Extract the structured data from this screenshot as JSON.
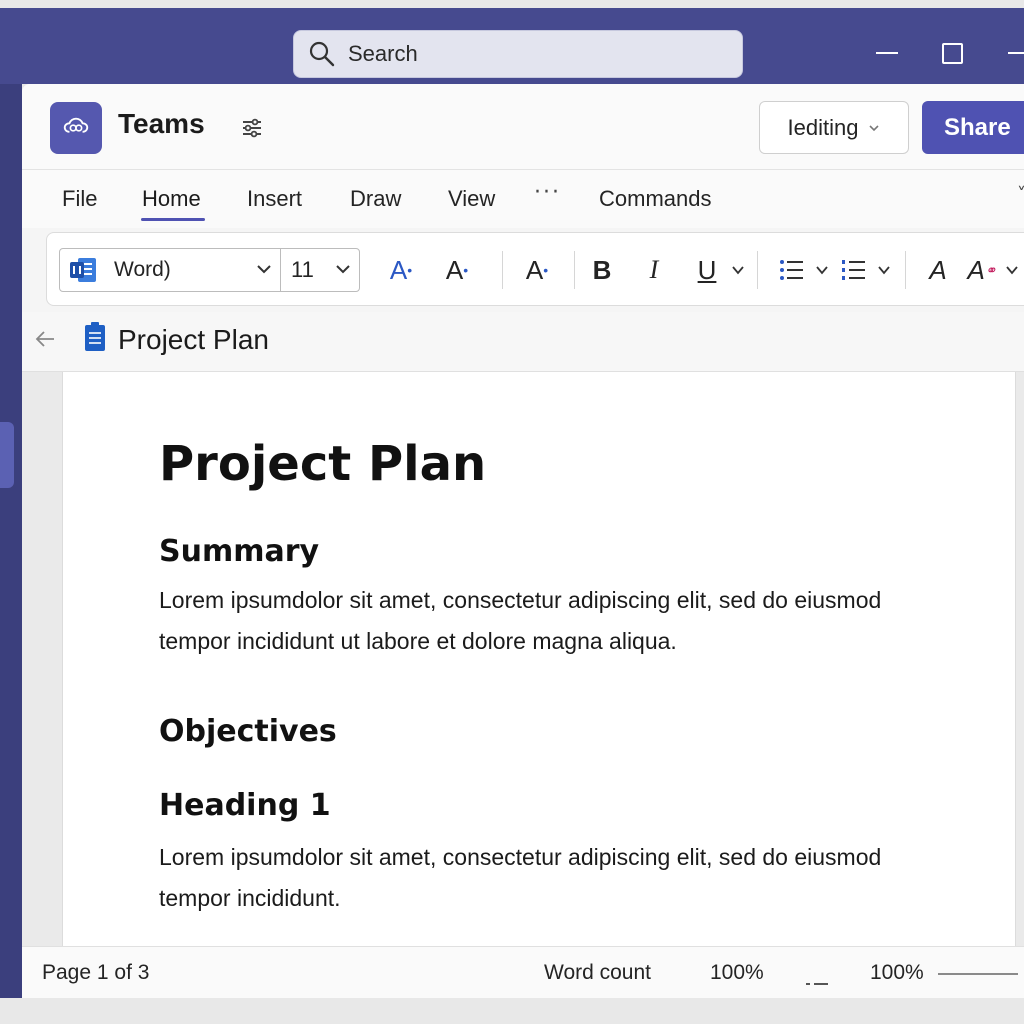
{
  "os": {
    "search_placeholder": "Search"
  },
  "app": {
    "name": "Teams",
    "mode_dropdown": "Iediting",
    "share_label": "Share",
    "accent_color": "#4f52b2"
  },
  "menu": {
    "tabs": [
      {
        "label": "File",
        "active": false
      },
      {
        "label": "Home",
        "active": true
      },
      {
        "label": "Insert",
        "active": false
      },
      {
        "label": "Draw",
        "active": false
      },
      {
        "label": "View",
        "active": false
      },
      {
        "label": "···",
        "active": false
      },
      {
        "label": "Commands",
        "active": false
      }
    ]
  },
  "ribbon": {
    "font_name": "Word)",
    "font_size": "11",
    "grow_font": "A",
    "shrink_font": "A",
    "clear_format": "A",
    "bold": "B",
    "italic": "I",
    "underline": "U",
    "text_highlight": "A",
    "font_color": "A"
  },
  "doc": {
    "title": "Project Plan",
    "heading": "Project Plan",
    "sections": [
      {
        "heading": "Summary",
        "body": "Lorem ipsumdolor sit amet, consectetur adipiscing elit, sed do eiusmod tempor incididunt ut labore et dolore magna aliqua."
      },
      {
        "heading": "Objectives",
        "body": ""
      },
      {
        "heading": "Heading 1",
        "body": "Lorem ipsumdolor sit amet, consectetur adipiscing elit, sed do eiusmod tempor incididunt."
      }
    ]
  },
  "status": {
    "page": "Page 1 of 3",
    "word_count": "Word count",
    "zoom_a": "100%",
    "zoom_b": "100%"
  }
}
